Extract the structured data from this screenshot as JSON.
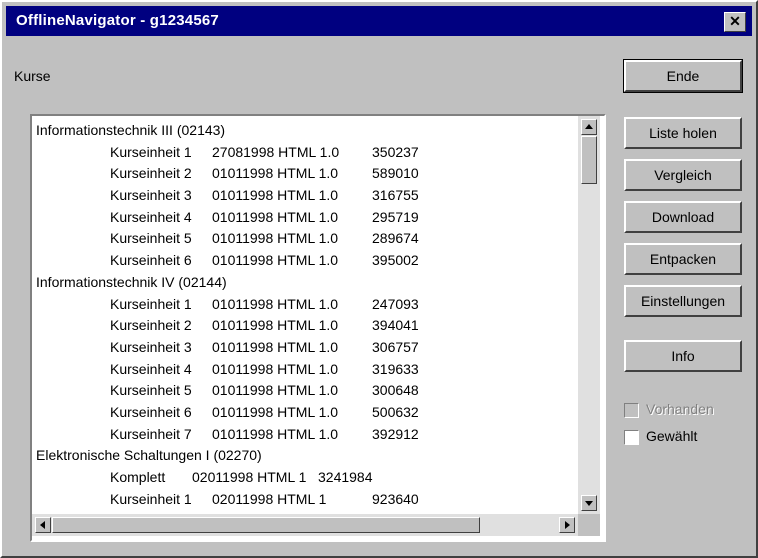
{
  "window": {
    "title": "OfflineNavigator - g1234567",
    "close_label": "✕"
  },
  "list_label": "Kurse",
  "courses": [
    {
      "title": "Informationstechnik III (02143)",
      "units": [
        {
          "name": "Kurseinheit 1",
          "version": "27081998 HTML 1.0",
          "size": "350237"
        },
        {
          "name": "Kurseinheit 2",
          "version": "01011998 HTML 1.0",
          "size": "589010"
        },
        {
          "name": "Kurseinheit 3",
          "version": "01011998 HTML 1.0",
          "size": "316755"
        },
        {
          "name": "Kurseinheit 4",
          "version": "01011998 HTML 1.0",
          "size": "295719"
        },
        {
          "name": "Kurseinheit 5",
          "version": "01011998 HTML 1.0",
          "size": "289674"
        },
        {
          "name": "Kurseinheit 6",
          "version": "01011998 HTML 1.0",
          "size": "395002"
        }
      ]
    },
    {
      "title": "Informationstechnik IV (02144)",
      "units": [
        {
          "name": "Kurseinheit 1",
          "version": "01011998 HTML 1.0",
          "size": "247093"
        },
        {
          "name": "Kurseinheit 2",
          "version": "01011998 HTML 1.0",
          "size": "394041"
        },
        {
          "name": "Kurseinheit 3",
          "version": "01011998 HTML 1.0",
          "size": "306757"
        },
        {
          "name": "Kurseinheit 4",
          "version": "01011998 HTML 1.0",
          "size": "319633"
        },
        {
          "name": "Kurseinheit 5",
          "version": "01011998 HTML 1.0",
          "size": "300648"
        },
        {
          "name": "Kurseinheit 6",
          "version": "01011998 HTML 1.0",
          "size": "500632"
        },
        {
          "name": "Kurseinheit 7",
          "version": "01011998 HTML 1.0",
          "size": "392912"
        }
      ]
    },
    {
      "title": "Elektronische Schaltungen I (02270)",
      "komplett": {
        "label": "Komplett",
        "version": "02011998 HTML 1",
        "size": "3241984"
      },
      "units": [
        {
          "name": "Kurseinheit 1",
          "version": "02011998 HTML 1",
          "size": "923640"
        }
      ]
    }
  ],
  "buttons": {
    "ende": "Ende",
    "liste_holen": "Liste holen",
    "vergleich": "Vergleich",
    "download": "Download",
    "entpacken": "Entpacken",
    "einstellungen": "Einstellungen",
    "info": "Info"
  },
  "checkboxes": {
    "vorhanden": {
      "label": "Vorhanden",
      "checked": false,
      "enabled": false
    },
    "gewaehlt": {
      "label": "Gewählt",
      "checked": false,
      "enabled": true
    }
  },
  "scroll": {
    "vertical_position": 0.0,
    "horizontal_position": 0.0
  }
}
